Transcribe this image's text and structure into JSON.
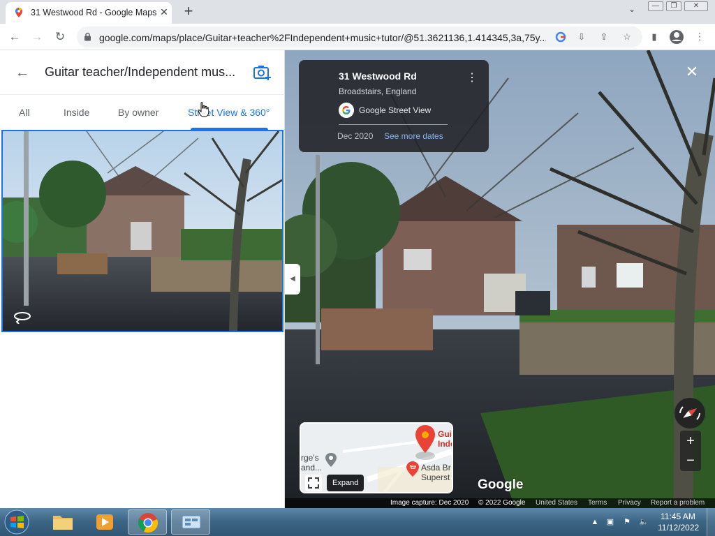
{
  "browser": {
    "tab_title": "31 Westwood Rd - Google Maps",
    "tab_close": "✕",
    "new_tab": "+",
    "url": "google.com/maps/place/Guitar+teacher%2FIndependent+music+tutor/@51.3621136,1.414345,3a,75y...",
    "window_controls": [
      "—",
      "❐",
      "✕"
    ]
  },
  "panel": {
    "title": "Guitar teacher/Independent mus...",
    "tabs": [
      "All",
      "Inside",
      "By owner",
      "Street View & 360°"
    ],
    "active_tab": "Street View & 360°"
  },
  "streetview": {
    "address": "31 Westwood Rd",
    "locality": "Broadstairs, England",
    "source": "Google Street View",
    "capture_date": "Dec 2020",
    "more_dates": "See more dates",
    "watermark": "Google",
    "footer": {
      "image_capture": "Image capture: Dec 2020",
      "copyright": "© 2022 Google",
      "region": "United States",
      "terms": "Terms",
      "privacy": "Privacy",
      "report": "Report a problem"
    }
  },
  "minimap": {
    "place_1": "rge's",
    "place_1b": "and...",
    "place_2": "Gui",
    "place_2b": "Inde",
    "place_3": "Asda Br",
    "place_3b": "Superst",
    "expand_tooltip": "Expand"
  },
  "taskbar": {
    "time": "11:45 AM",
    "date": "11/12/2022"
  },
  "icons": {
    "back": "back-arrow-icon",
    "add_photo": "add-photo-icon",
    "rotate_360": "360-rotate-icon",
    "compass": "compass-icon"
  },
  "colors": {
    "accent": "#1a73e8",
    "link": "#8ab4f8",
    "pin": "#ea4335"
  }
}
